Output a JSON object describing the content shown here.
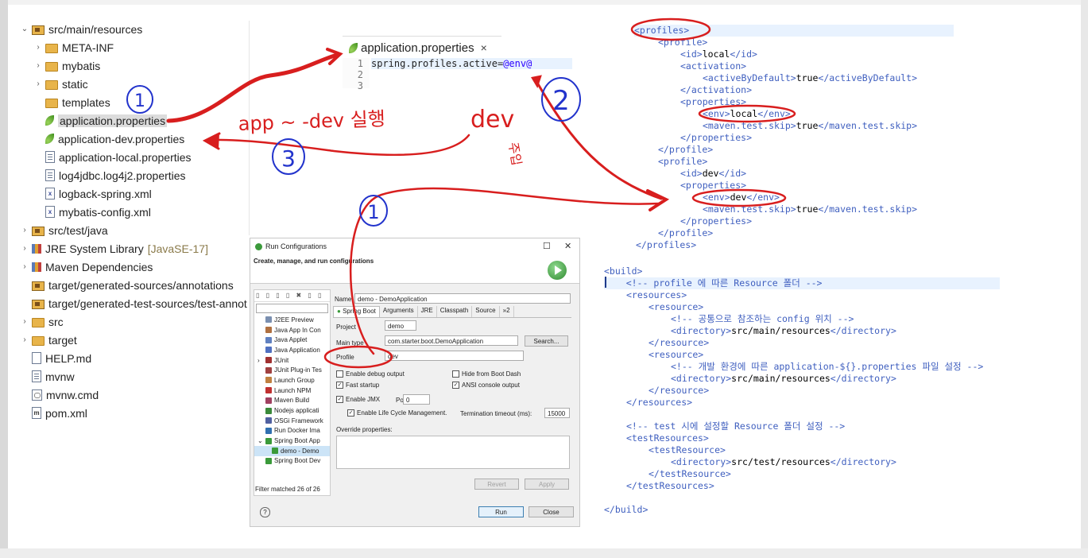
{
  "tree": {
    "items": [
      {
        "label": "src/main/resources",
        "icon": "package-folder-icon",
        "twisty": "⌄"
      },
      {
        "label": "META-INF",
        "icon": "folder-icon",
        "twisty": "›"
      },
      {
        "label": "mybatis",
        "icon": "folder-icon",
        "twisty": "›"
      },
      {
        "label": "static",
        "icon": "folder-icon",
        "twisty": "›"
      },
      {
        "label": "templates",
        "icon": "folder-icon",
        "twisty": ""
      },
      {
        "label": "application.properties",
        "icon": "spring-leaf-icon",
        "twisty": ""
      },
      {
        "label": "application-dev.properties",
        "icon": "spring-leaf-icon",
        "twisty": ""
      },
      {
        "label": "application-local.properties",
        "icon": "file-icon",
        "twisty": ""
      },
      {
        "label": "log4jdbc.log4j2.properties",
        "icon": "file-icon",
        "twisty": ""
      },
      {
        "label": "logback-spring.xml",
        "icon": "xml-file-icon",
        "twisty": ""
      },
      {
        "label": "mybatis-config.xml",
        "icon": "xml-file-icon",
        "twisty": ""
      },
      {
        "label": "src/test/java",
        "icon": "package-folder-icon",
        "twisty": "›"
      },
      {
        "label": "JRE System Library",
        "suffix": "[JavaSE-17]",
        "icon": "library-icon",
        "twisty": "›"
      },
      {
        "label": "Maven Dependencies",
        "icon": "library-icon",
        "twisty": "›"
      },
      {
        "label": "target/generated-sources/annotations",
        "icon": "package-folder-icon",
        "twisty": ""
      },
      {
        "label": "target/generated-test-sources/test-annot",
        "icon": "package-folder-icon",
        "twisty": ""
      },
      {
        "label": "src",
        "icon": "folder-icon",
        "twisty": "›"
      },
      {
        "label": "target",
        "icon": "folder-icon",
        "twisty": "›"
      },
      {
        "label": "HELP.md",
        "icon": "markdown-file-icon",
        "twisty": ""
      },
      {
        "label": "mvnw",
        "icon": "file-icon",
        "twisty": ""
      },
      {
        "label": "mvnw.cmd",
        "icon": "cmd-file-icon",
        "twisty": ""
      },
      {
        "label": "pom.xml",
        "icon": "pom-file-icon",
        "twisty": ""
      }
    ]
  },
  "editor": {
    "tab_label": "application.properties",
    "close_glyph": "×",
    "line_numbers": [
      "1",
      "2",
      "3"
    ],
    "line1_key": "spring.profiles.active=",
    "line1_value": "@env@"
  },
  "dialog": {
    "title": "Run Configurations",
    "header": "Create, manage, and run configurations",
    "toolbar_glyphs": "▯ ▯ ▯ ▯ ✖ ▯ ▯",
    "list": [
      {
        "label": "J2EE Preview",
        "color": "#7a8fb0"
      },
      {
        "label": "Java App In Con",
        "color": "#b07040"
      },
      {
        "label": "Java Applet",
        "color": "#6080c0"
      },
      {
        "label": "Java Application",
        "color": "#5070c0"
      },
      {
        "label": "JUnit",
        "color": "#a03030",
        "twisty": "›"
      },
      {
        "label": "JUnit Plug-in Tes",
        "color": "#a04040"
      },
      {
        "label": "Launch Group",
        "color": "#c08040"
      },
      {
        "label": "Launch NPM",
        "color": "#c03030"
      },
      {
        "label": "Maven Build",
        "color": "#a04060"
      },
      {
        "label": "Nodejs applicati",
        "color": "#3a8a3a"
      },
      {
        "label": "OSGi Framework",
        "color": "#5060a0"
      },
      {
        "label": "Run Docker Ima",
        "color": "#3070b0"
      },
      {
        "label": "Spring Boot App",
        "color": "#3a9a3a",
        "twisty": "⌄"
      },
      {
        "label": "demo - Demo",
        "color": "#3a9a3a",
        "selected": true
      },
      {
        "label": "Spring Boot Dev",
        "color": "#3a9a3a"
      }
    ],
    "filter_status": "Filter matched 26 of 26",
    "name_label": "Name:",
    "name_value": "demo - DemoApplication",
    "tabs": [
      "Spring Boot",
      "Arguments",
      "JRE",
      "Classpath",
      "Source",
      "»2"
    ],
    "project_label": "Project",
    "project_value": "demo",
    "main_type_label": "Main type",
    "main_type_value": "com.starter.boot.DemoApplication",
    "search_button": "Search...",
    "profile_label": "Profile",
    "profile_value": "dev",
    "enable_debug": "Enable debug output",
    "hide_boot_dash": "Hide from Boot Dash",
    "fast_startup": "Fast startup",
    "ansi_console": "ANSI console output",
    "enable_jmx": "Enable JMX",
    "port_label": "Port:",
    "port_value": "0",
    "lifecycle": "Enable Life Cycle Management.",
    "termination_label": "Termination timeout (ms):",
    "termination_value": "15000",
    "override_label": "Override properties:",
    "revert": "Revert",
    "apply": "Apply",
    "run": "Run",
    "close": "Close",
    "help": "?"
  },
  "pom": {
    "profiles_open": "<profiles>",
    "profile_open": "<profile>",
    "id_local": "local",
    "activation_open": "<activation>",
    "active_by_default": "true",
    "activation_close": "</activation>",
    "properties_open": "<properties>",
    "env_local": "local",
    "skip_true": "true",
    "properties_close": "</properties>",
    "profile_close": "</profile>",
    "id_dev": "dev",
    "env_dev": "dev",
    "profiles_close": "</profiles>",
    "build_open": "<build>",
    "comment_resource": "<!-- profile 에 따른 Resource 폴더 -->",
    "resources_open": "<resources>",
    "resource_open": "<resource>",
    "comment_common": "<!-- 공통으로 참조하는 config 위치 -->",
    "dir_main": "src/main/resources",
    "resource_close": "</resource>",
    "comment_env": "<!-- 개발 환경에 따른 application-${}.properties 파일 설정 -->",
    "resources_close": "</resources>",
    "comment_test": "<!-- test 시에 설정할 Resource 폴더 설정 -->",
    "test_resources_open": "<testResources>",
    "test_resource_open": "<testResource>",
    "dir_test": "src/test/resources",
    "test_resource_close": "</testResource>",
    "test_resources_close": "</testResources>",
    "build_close": "</build>"
  },
  "annotations": {
    "step1_top": "1",
    "step2": "2",
    "step3": "3",
    "step1_dialog": "1",
    "note_app_dev": "app ~ -dev 실행",
    "note_dev": "dev",
    "note_inject": "주입",
    "colors": {
      "red": "#d81e1e",
      "blue": "#2233cc"
    }
  }
}
